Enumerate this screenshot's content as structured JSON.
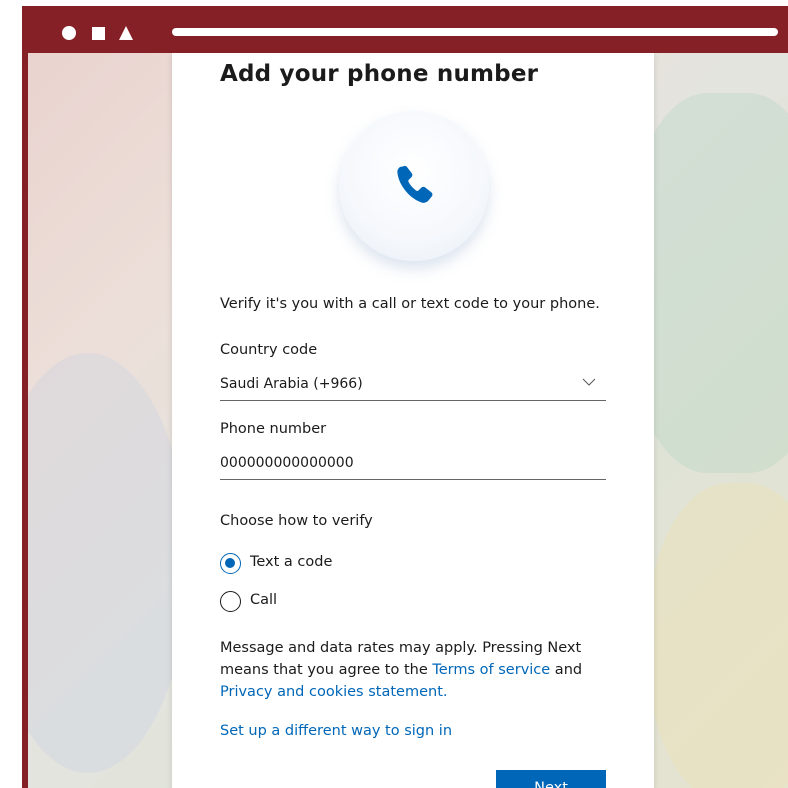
{
  "window": {
    "controls": [
      "circle",
      "square",
      "triangle"
    ]
  },
  "page": {
    "title": "Add your phone number",
    "icon": "phone-icon",
    "description": "Verify it's you with a call or text code to your phone.",
    "country_code": {
      "label": "Country code",
      "selected": "Saudi Arabia (+966)"
    },
    "phone_number": {
      "label": "Phone number",
      "value": "000000000000000"
    },
    "verify": {
      "label": "Choose how to verify",
      "options": [
        {
          "label": "Text a code",
          "checked": true
        },
        {
          "label": "Call",
          "checked": false
        }
      ]
    },
    "legal": {
      "text_before": "Message and data rates may apply. Pressing Next means that you agree to the ",
      "terms_link": "Terms of service",
      "text_middle": " and ",
      "privacy_link": "Privacy and cookies statement.",
      "text_after": ""
    },
    "alt_signin_link": "Set up a different way to sign in",
    "next_button": "Next"
  },
  "colors": {
    "browser_frame": "#852027",
    "accent": "#0067b8"
  }
}
